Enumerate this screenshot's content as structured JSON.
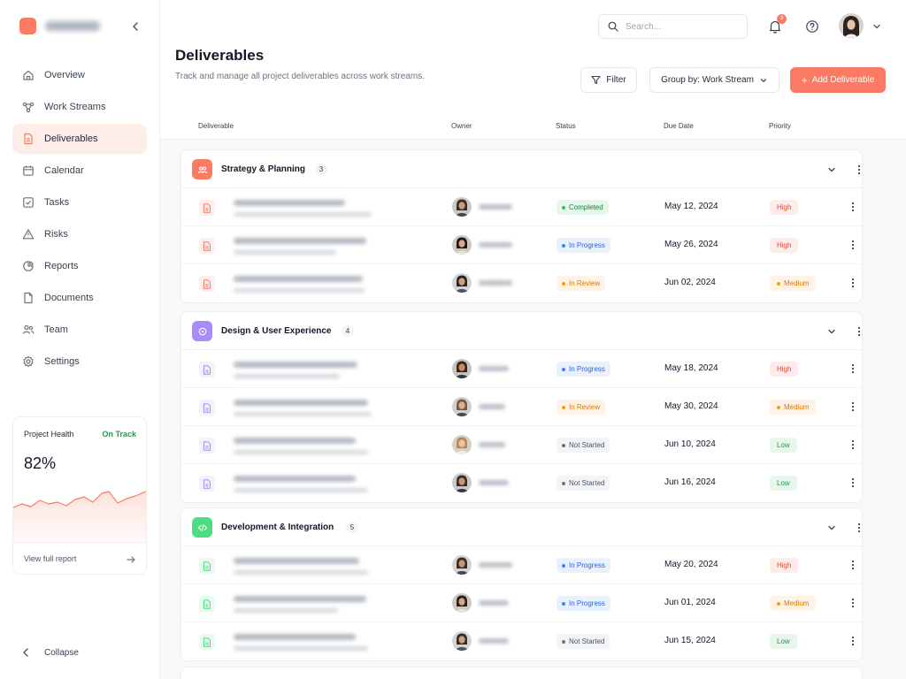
{
  "colors": {
    "accent": "#fb7a63",
    "strategy": "#fb7a63",
    "design": "#a78bfa",
    "development": "#4ade80"
  },
  "sidebar": {
    "items": [
      {
        "label": "Overview",
        "icon": "home-icon",
        "name": "sidebar-item-overview"
      },
      {
        "label": "Work Streams",
        "icon": "work-streams-icon",
        "name": "sidebar-item-work-streams"
      },
      {
        "label": "Deliverables",
        "icon": "document-icon",
        "name": "sidebar-item-deliverables",
        "active": true
      },
      {
        "label": "Calendar",
        "icon": "calendar-icon",
        "name": "sidebar-item-calendar"
      },
      {
        "label": "Tasks",
        "icon": "checkbox-icon",
        "name": "sidebar-item-tasks"
      },
      {
        "label": "Risks",
        "icon": "warning-icon",
        "name": "sidebar-item-risks"
      },
      {
        "label": "Reports",
        "icon": "chart-icon",
        "name": "sidebar-item-reports"
      },
      {
        "label": "Documents",
        "icon": "file-icon",
        "name": "sidebar-item-documents"
      },
      {
        "label": "Team",
        "icon": "team-icon",
        "name": "sidebar-item-team"
      },
      {
        "label": "Settings",
        "icon": "gear-icon",
        "name": "sidebar-item-settings"
      }
    ],
    "health": {
      "title": "Project Health",
      "status": "On Track",
      "value": "82%",
      "link": "View full report"
    },
    "collapse": "Collapse"
  },
  "topbar": {
    "search_placeholder": "Search...",
    "notification_count": "3"
  },
  "header": {
    "title": "Deliverables",
    "subtitle": "Track and manage all project deliverables across work streams.",
    "filter_label": "Filter",
    "group_label": "Group by: Work Stream",
    "add_label": "Add Deliverable"
  },
  "columns": {
    "deliverable": "Deliverable",
    "owner": "Owner",
    "status": "Status",
    "due": "Due Date",
    "priority": "Priority"
  },
  "groups": [
    {
      "title": "Strategy & Planning",
      "count": "3",
      "color": "#fb7a63",
      "rows": [
        {
          "status": "Completed",
          "status_kind": "completed",
          "due": "May 12, 2024",
          "priority": "High",
          "priority_kind": "high"
        },
        {
          "status": "In Progress",
          "status_kind": "progress",
          "due": "May 26, 2024",
          "priority": "High",
          "priority_kind": "high"
        },
        {
          "status": "In Review",
          "status_kind": "review",
          "due": "Jun 02, 2024",
          "priority": "Medium",
          "priority_kind": "medium"
        }
      ]
    },
    {
      "title": "Design & User Experience",
      "count": "4",
      "color": "#a78bfa",
      "rows": [
        {
          "status": "In Progress",
          "status_kind": "progress",
          "due": "May 18, 2024",
          "priority": "High",
          "priority_kind": "high"
        },
        {
          "status": "In Review",
          "status_kind": "review",
          "due": "May 30, 2024",
          "priority": "Medium",
          "priority_kind": "medium"
        },
        {
          "status": "Not Started",
          "status_kind": "notstarted",
          "due": "Jun 10, 2024",
          "priority": "Low",
          "priority_kind": "low"
        },
        {
          "status": "Not Started",
          "status_kind": "notstarted",
          "due": "Jun 16, 2024",
          "priority": "Low",
          "priority_kind": "low"
        }
      ]
    },
    {
      "title": "Development & Integration",
      "count": "5",
      "color": "#4ade80",
      "rows": [
        {
          "status": "In Progress",
          "status_kind": "progress",
          "due": "May 20, 2024",
          "priority": "High",
          "priority_kind": "high"
        },
        {
          "status": "In Progress",
          "status_kind": "progress",
          "due": "Jun 01, 2024",
          "priority": "Medium",
          "priority_kind": "medium"
        },
        {
          "status": "Not Started",
          "status_kind": "notstarted",
          "due": "Jun 15, 2024",
          "priority": "Low",
          "priority_kind": "low"
        }
      ]
    }
  ]
}
